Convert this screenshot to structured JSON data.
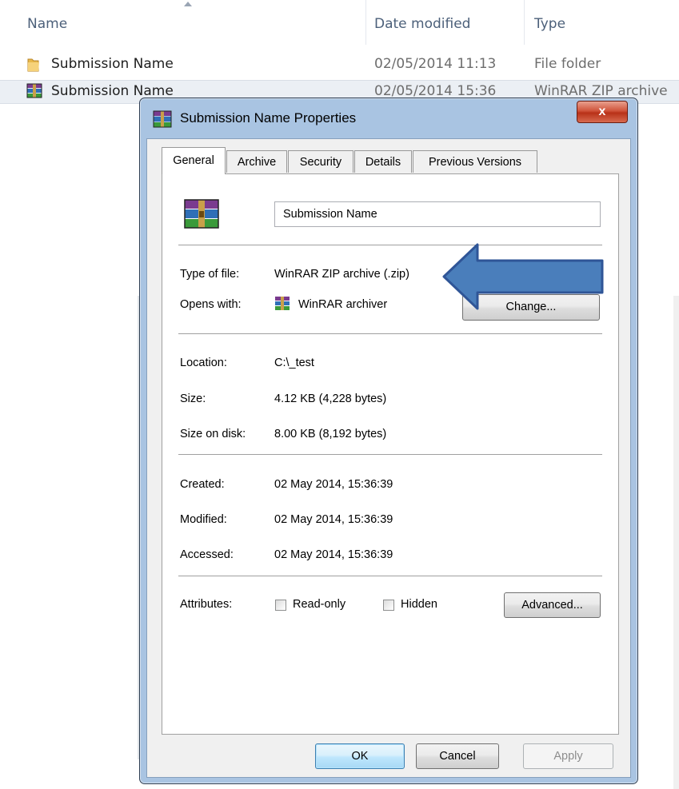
{
  "explorer": {
    "columns": {
      "name": "Name",
      "date": "Date modified",
      "type": "Type"
    },
    "rows": [
      {
        "name": "Submission Name",
        "date": "02/05/2014 11:13",
        "type": "File folder",
        "icon": "folder-icon"
      },
      {
        "name": "Submission Name",
        "date": "02/05/2014 15:36",
        "type": "WinRAR ZIP archive",
        "icon": "winrar-icon"
      }
    ]
  },
  "dialog": {
    "title": "Submission Name Properties",
    "close_label": "x",
    "tabs": [
      {
        "label": "General",
        "active": true
      },
      {
        "label": "Archive"
      },
      {
        "label": "Security"
      },
      {
        "label": "Details"
      },
      {
        "label": "Previous Versions"
      }
    ],
    "general": {
      "file_name": "Submission Name",
      "type_label": "Type of file:",
      "type_value": "WinRAR ZIP archive (.zip)",
      "opens_label": "Opens with:",
      "opens_value": "WinRAR archiver",
      "change_label": "Change...",
      "location_label": "Location:",
      "location_value": "C:\\_test",
      "size_label": "Size:",
      "size_value": "4.12 KB (4,228 bytes)",
      "size_disk_label": "Size on disk:",
      "size_disk_value": "8.00 KB (8,192 bytes)",
      "created_label": "Created:",
      "created_value": "02 May 2014, 15:36:39",
      "modified_label": "Modified:",
      "modified_value": "02 May 2014, 15:36:39",
      "accessed_label": "Accessed:",
      "accessed_value": "02 May 2014, 15:36:39",
      "attributes_label": "Attributes:",
      "readonly_label": "Read-only",
      "hidden_label": "Hidden",
      "advanced_label": "Advanced..."
    },
    "buttons": {
      "ok": "OK",
      "cancel": "Cancel",
      "apply": "Apply"
    }
  },
  "colors": {
    "annotation_arrow": "#4a7ebb",
    "annotation_arrow_outline": "#2f5597",
    "dialog_frame": "#a9c4e2",
    "close_button": "#c9452c"
  }
}
